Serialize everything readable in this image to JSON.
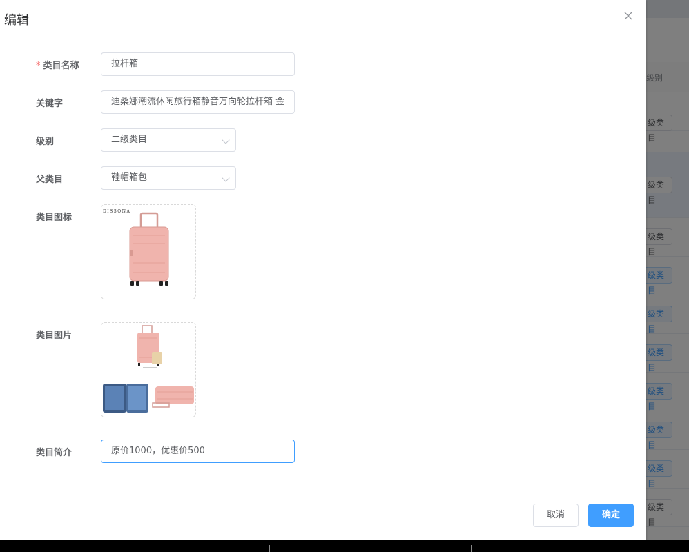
{
  "dialog": {
    "title": "编辑",
    "close_icon": "close-icon"
  },
  "form": {
    "name": {
      "label": "类目名称",
      "required_mark": "*",
      "value": "拉杆箱"
    },
    "keywords": {
      "label": "关键字",
      "value": "迪桑娜潮流休闲旅行箱静音万向轮拉杆箱 金"
    },
    "level": {
      "label": "级别",
      "value": "二级类目"
    },
    "parent": {
      "label": "父类目",
      "value": "鞋帽箱包"
    },
    "icon": {
      "label": "类目图标",
      "brand_text": "DISSONA"
    },
    "picture": {
      "label": "类目图片"
    },
    "intro": {
      "label": "类目简介",
      "value": "原价1000，优惠价500"
    }
  },
  "footer": {
    "cancel_label": "取消",
    "ok_label": "确定"
  },
  "background": {
    "column_header": "级别",
    "tags": [
      "级类目",
      "级类目",
      "级类目",
      "级类目",
      "级类目",
      "级类目",
      "级类目",
      "级类目",
      "级类目",
      "级类目"
    ]
  },
  "colors": {
    "primary": "#409eff",
    "required": "#f56c6c",
    "suitcase": "#f0b4ad"
  }
}
